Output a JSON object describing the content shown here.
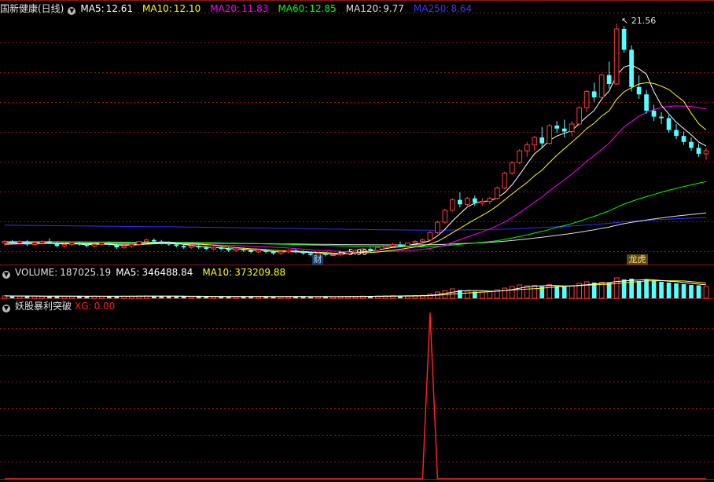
{
  "colors": {
    "ma5": "#ffffff",
    "ma10": "#ffff00",
    "ma20": "#ff00ff",
    "ma60": "#00ff00",
    "ma120": "#e0e0e0",
    "ma250": "#2f2fff",
    "up": "#ff3b3b",
    "down": "#54ffff",
    "grid": "#8a1a1a",
    "volMa10": "#ffff00",
    "xg": "#ff2020"
  },
  "icons": [
    "chevron-down-icon",
    "arrow-icon"
  ],
  "price": {
    "title": "国新健康(日线)",
    "ma5": {
      "label": "MA5:",
      "value": "12.61"
    },
    "ma10": {
      "label": "MA10:",
      "value": "12.10"
    },
    "ma20": {
      "label": "MA20:",
      "value": "11.83"
    },
    "ma60": {
      "label": "MA60:",
      "value": "12.85"
    },
    "ma120": {
      "label": "MA120:",
      "value": "9.77"
    },
    "ma250": {
      "label": "MA250:",
      "value": "8.64"
    },
    "high_label": "21.56",
    "low_label": "5.90",
    "tags": {
      "cai": "财",
      "longhu": "龙虎"
    }
  },
  "volume": {
    "title": "VOLUME:",
    "value": "187025.19",
    "ma5": {
      "label": "MA5:",
      "value": "346488.84"
    },
    "ma10": {
      "label": "MA10:",
      "value": "373209.88"
    }
  },
  "indicator": {
    "title": "妖股暴利突破",
    "xg": {
      "label": "XG:",
      "value": "0.00"
    }
  },
  "chart_data": {
    "type": "candlestick",
    "high": 21.56,
    "low": 5.9,
    "candles": [
      [
        6.8,
        7.0,
        6.6,
        6.9
      ],
      [
        6.9,
        7.0,
        6.7,
        6.8
      ],
      [
        6.8,
        7.0,
        6.7,
        6.9
      ],
      [
        6.9,
        7.0,
        6.6,
        6.7
      ],
      [
        6.7,
        6.9,
        6.6,
        6.8
      ],
      [
        6.8,
        7.0,
        6.7,
        6.9
      ],
      [
        6.9,
        7.1,
        6.8,
        6.8
      ],
      [
        6.8,
        6.9,
        6.5,
        6.6
      ],
      [
        6.6,
        6.8,
        6.5,
        6.7
      ],
      [
        6.7,
        6.9,
        6.6,
        6.8
      ],
      [
        6.8,
        6.9,
        6.6,
        6.7
      ],
      [
        6.7,
        6.8,
        6.5,
        6.6
      ],
      [
        6.6,
        6.8,
        6.5,
        6.7
      ],
      [
        6.7,
        6.9,
        6.6,
        6.8
      ],
      [
        6.8,
        6.9,
        6.6,
        6.7
      ],
      [
        6.7,
        6.8,
        6.4,
        6.5
      ],
      [
        6.5,
        6.7,
        6.4,
        6.6
      ],
      [
        6.6,
        6.8,
        6.5,
        6.7
      ],
      [
        6.7,
        6.9,
        6.6,
        6.9
      ],
      [
        6.9,
        7.1,
        6.8,
        7.0
      ],
      [
        7.0,
        7.1,
        6.8,
        6.9
      ],
      [
        6.9,
        7.0,
        6.7,
        6.8
      ],
      [
        6.8,
        6.9,
        6.6,
        6.7
      ],
      [
        6.7,
        6.8,
        6.5,
        6.6
      ],
      [
        6.6,
        6.7,
        6.4,
        6.5
      ],
      [
        6.5,
        6.7,
        6.4,
        6.6
      ],
      [
        6.6,
        6.7,
        6.4,
        6.5
      ],
      [
        6.5,
        6.6,
        6.3,
        6.4
      ],
      [
        6.4,
        6.6,
        6.3,
        6.5
      ],
      [
        6.5,
        6.6,
        6.3,
        6.4
      ],
      [
        6.4,
        6.5,
        6.2,
        6.3
      ],
      [
        6.3,
        6.5,
        6.2,
        6.4
      ],
      [
        6.4,
        6.5,
        6.2,
        6.3
      ],
      [
        6.3,
        6.4,
        6.1,
        6.2
      ],
      [
        6.2,
        6.4,
        6.1,
        6.3
      ],
      [
        6.3,
        6.4,
        6.1,
        6.2
      ],
      [
        6.2,
        6.3,
        6.0,
        6.1
      ],
      [
        6.1,
        6.3,
        6.0,
        6.2
      ],
      [
        6.2,
        6.4,
        6.1,
        6.3
      ],
      [
        6.3,
        6.4,
        6.1,
        6.2
      ],
      [
        6.2,
        6.3,
        6.0,
        6.1
      ],
      [
        6.1,
        6.2,
        5.9,
        6.0
      ],
      [
        6.0,
        6.2,
        5.9,
        6.1
      ],
      [
        6.1,
        6.2,
        5.9,
        6.0
      ],
      [
        6.0,
        6.1,
        5.9,
        6.0
      ],
      [
        6.0,
        6.2,
        5.9,
        6.1
      ],
      [
        6.1,
        6.3,
        6.0,
        6.2
      ],
      [
        6.2,
        6.4,
        6.1,
        6.3
      ],
      [
        6.3,
        6.5,
        6.2,
        6.4
      ],
      [
        6.4,
        6.5,
        6.2,
        6.3
      ],
      [
        6.3,
        6.5,
        6.2,
        6.5
      ],
      [
        6.5,
        6.7,
        6.4,
        6.6
      ],
      [
        6.6,
        6.8,
        6.5,
        6.7
      ],
      [
        6.7,
        6.9,
        6.5,
        6.6
      ],
      [
        6.6,
        6.8,
        6.5,
        6.8
      ],
      [
        6.8,
        7.0,
        6.7,
        6.9
      ],
      [
        6.9,
        7.1,
        6.8,
        7.0
      ],
      [
        7.0,
        7.6,
        6.9,
        7.5
      ],
      [
        7.5,
        8.3,
        7.4,
        8.2
      ],
      [
        8.2,
        9.1,
        8.1,
        9.0
      ],
      [
        9.0,
        9.8,
        8.9,
        9.7
      ],
      [
        9.7,
        10.2,
        9.2,
        9.4
      ],
      [
        9.4,
        9.9,
        9.2,
        9.8
      ],
      [
        9.8,
        10.0,
        9.3,
        9.5
      ],
      [
        9.5,
        9.8,
        9.3,
        9.6
      ],
      [
        9.6,
        9.9,
        9.4,
        9.8
      ],
      [
        9.8,
        10.6,
        9.7,
        10.5
      ],
      [
        10.5,
        11.6,
        10.4,
        11.5
      ],
      [
        11.5,
        12.3,
        11.4,
        12.2
      ],
      [
        12.2,
        13.1,
        12.1,
        13.0
      ],
      [
        13.0,
        13.6,
        12.6,
        13.4
      ],
      [
        13.4,
        14.0,
        13.0,
        13.9
      ],
      [
        13.9,
        14.6,
        13.2,
        13.5
      ],
      [
        13.5,
        14.8,
        13.4,
        14.7
      ],
      [
        14.7,
        15.0,
        14.2,
        14.5
      ],
      [
        14.5,
        15.1,
        13.9,
        14.3
      ],
      [
        14.3,
        15.0,
        14.0,
        14.8
      ],
      [
        14.8,
        16.0,
        14.7,
        15.9
      ],
      [
        15.9,
        17.1,
        15.6,
        17.0
      ],
      [
        17.0,
        17.6,
        16.3,
        16.6
      ],
      [
        16.6,
        18.2,
        16.5,
        18.1
      ],
      [
        18.1,
        19.0,
        17.2,
        17.5
      ],
      [
        17.5,
        21.56,
        17.4,
        21.2
      ],
      [
        21.2,
        21.4,
        19.6,
        19.8
      ],
      [
        19.8,
        20.1,
        17.0,
        17.3
      ],
      [
        17.3,
        18.1,
        16.5,
        16.8
      ],
      [
        16.8,
        17.1,
        15.5,
        15.7
      ],
      [
        15.7,
        16.1,
        15.0,
        15.3
      ],
      [
        15.3,
        15.6,
        14.8,
        15.2
      ],
      [
        15.2,
        15.4,
        14.2,
        14.4
      ],
      [
        14.4,
        14.8,
        13.8,
        14.0
      ],
      [
        14.0,
        14.3,
        13.4,
        13.6
      ],
      [
        13.6,
        13.9,
        13.0,
        13.2
      ],
      [
        13.2,
        13.5,
        12.6,
        12.8
      ],
      [
        12.8,
        13.2,
        12.4,
        13.0
      ]
    ],
    "volume": [
      62,
      58,
      55,
      60,
      52,
      48,
      50,
      57,
      54,
      51,
      49,
      53,
      56,
      50,
      47,
      52,
      54,
      55,
      58,
      60,
      57,
      53,
      50,
      48,
      45,
      47,
      46,
      44,
      48,
      45,
      43,
      46,
      44,
      42,
      45,
      43,
      41,
      44,
      46,
      43,
      42,
      40,
      44,
      43,
      41,
      45,
      47,
      50,
      55,
      53,
      58,
      62,
      66,
      60,
      65,
      70,
      75,
      110,
      160,
      190,
      240,
      210,
      185,
      170,
      160,
      175,
      220,
      260,
      300,
      340,
      320,
      330,
      300,
      350,
      310,
      290,
      320,
      380,
      420,
      400,
      410,
      390,
      520,
      480,
      500,
      440,
      470,
      450,
      420,
      400,
      380,
      360,
      340,
      330,
      300
    ],
    "xg": [
      0,
      0,
      0,
      0,
      0,
      0,
      0,
      0,
      0,
      0,
      0,
      0,
      0,
      0,
      0,
      0,
      0,
      0,
      0,
      0,
      0,
      0,
      0,
      0,
      0,
      0,
      0,
      0,
      0,
      0,
      0,
      0,
      0,
      0,
      0,
      0,
      0,
      0,
      0,
      0,
      0,
      0,
      0,
      0,
      0,
      0,
      0,
      0,
      0,
      0,
      0,
      0,
      0,
      0,
      0,
      0,
      0,
      1,
      0,
      0,
      0,
      0,
      0,
      0,
      0,
      0,
      0,
      0,
      0,
      0,
      0,
      0,
      0,
      0,
      0,
      0,
      0,
      0,
      0,
      0,
      0,
      0,
      0,
      0,
      0,
      0,
      0,
      0,
      0,
      0,
      0,
      0,
      0,
      0,
      0
    ]
  }
}
